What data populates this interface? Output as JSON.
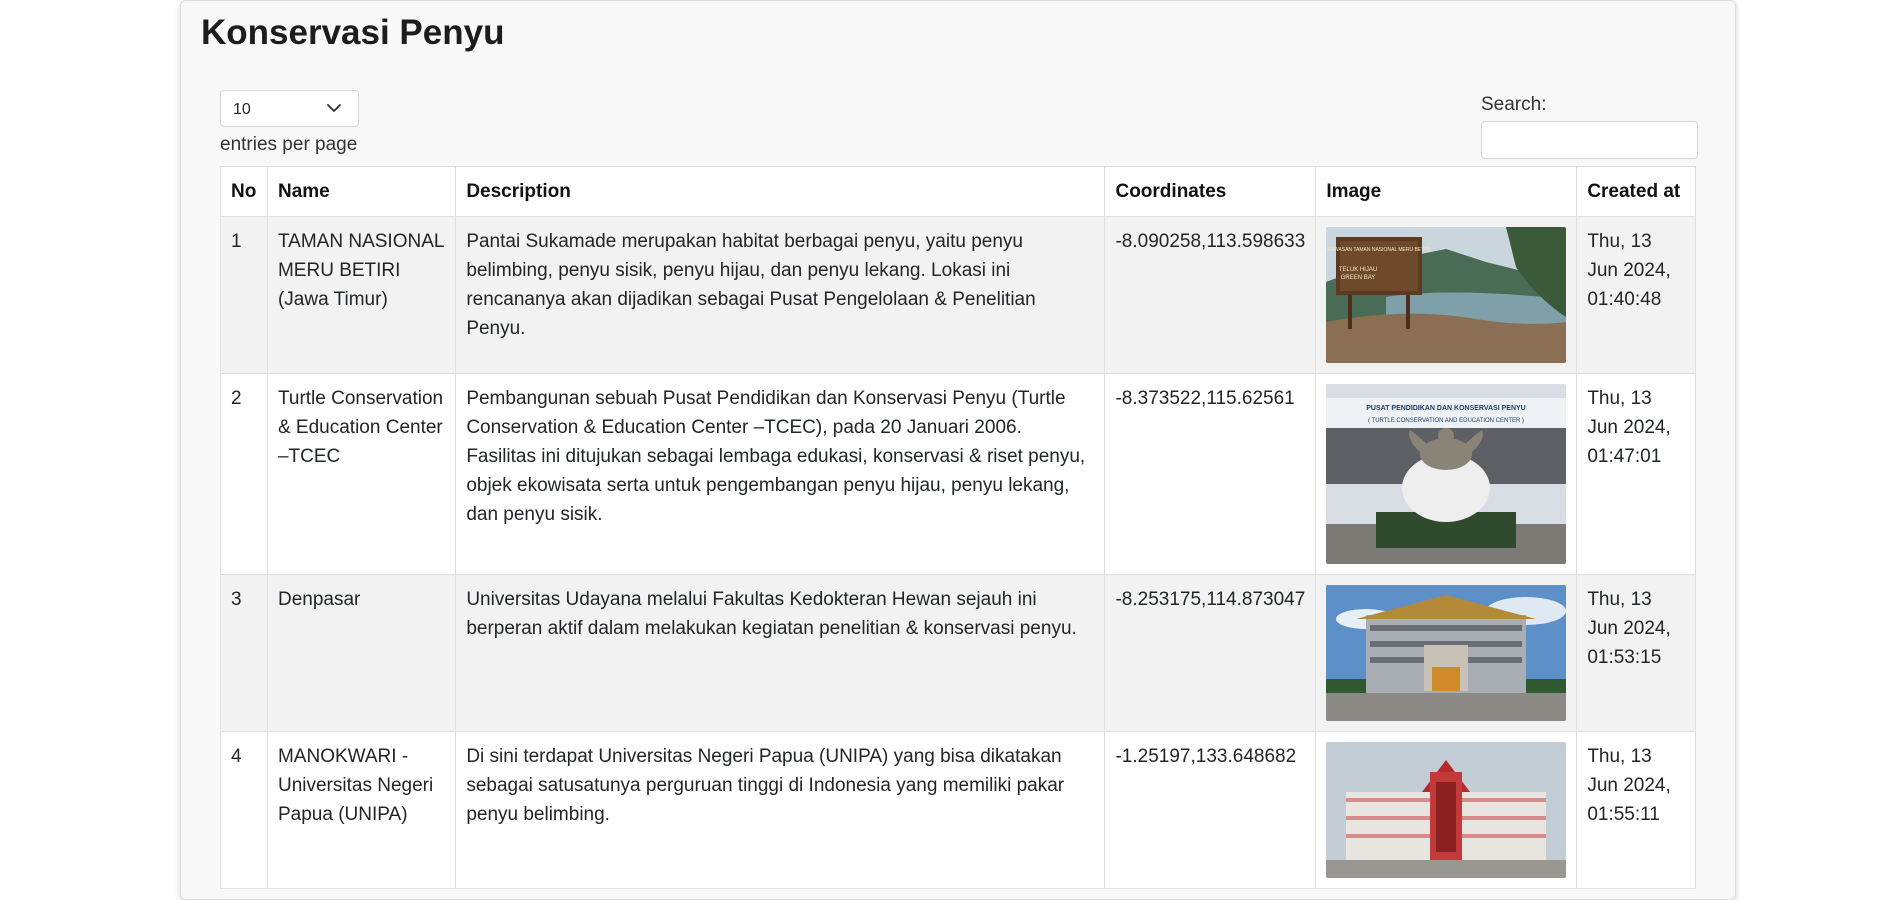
{
  "page": {
    "title": "Konservasi Penyu"
  },
  "length": {
    "value": "10",
    "label": "entries per page"
  },
  "search": {
    "label": "Search:",
    "value": "",
    "placeholder": ""
  },
  "table": {
    "headers": [
      "No",
      "Name",
      "Description",
      "Coordinates",
      "Image",
      "Created at"
    ],
    "rows": [
      {
        "no": "1",
        "name": "TAMAN NASIONAL MERU BETIRI (Jawa Timur)",
        "description": "Pantai Sukamade merupakan habitat berbagai penyu, yaitu penyu belimbing, penyu sisik, penyu hijau, dan penyu lekang. Lokasi ini rencananya akan dijadikan sebagai Pusat Pengelolaan & Penelitian Penyu.",
        "coordinates": "-8.090258,113.598633",
        "image_sign": "KAWASAN TAMAN NASIONAL MERU BETIRI",
        "image_sign2": "TELUK HIJAU",
        "image_sign3": "GREEN BAY",
        "created": "Thu, 13 Jun 2024, 01:40:48"
      },
      {
        "no": "2",
        "name": "Turtle Conservation & Education Center –TCEC",
        "description": "Pembangunan sebuah Pusat Pendidikan dan Konservasi Penyu (Turtle Conservation & Education Center –TCEC), pada 20 Januari 2006. Fasilitas ini ditujukan sebagai lembaga edukasi, konservasi & riset penyu, objek ekowisata serta untuk pengembangan penyu hijau, penyu lekang, dan penyu sisik.",
        "coordinates": "-8.373522,115.62561",
        "image_sign": "PUSAT PENDIDIKAN DAN KONSERVASI PENYU",
        "image_sign2": "( TURTLE CONSERVATION AND EDUCATION CENTER )",
        "created": "Thu, 13 Jun 2024, 01:47:01"
      },
      {
        "no": "3",
        "name": "Denpasar",
        "description": "Universitas Udayana melalui Fakultas Kedokteran Hewan sejauh ini berperan aktif dalam melakukan kegiatan penelitian & konservasi penyu.",
        "coordinates": "-8.253175,114.873047",
        "created": "Thu, 13 Jun 2024, 01:53:15"
      },
      {
        "no": "4",
        "name": "MANOKWARI - Universitas Negeri Papua (UNIPA)",
        "description": "Di sini terdapat Universitas Negeri Papua (UNIPA) yang bisa dikatakan sebagai satusatunya perguruan tinggi di Indonesia yang memiliki pakar penyu belimbing.",
        "coordinates": "-1.25197,133.648682",
        "created": "Thu, 13 Jun 2024, 01:55:11"
      }
    ]
  }
}
